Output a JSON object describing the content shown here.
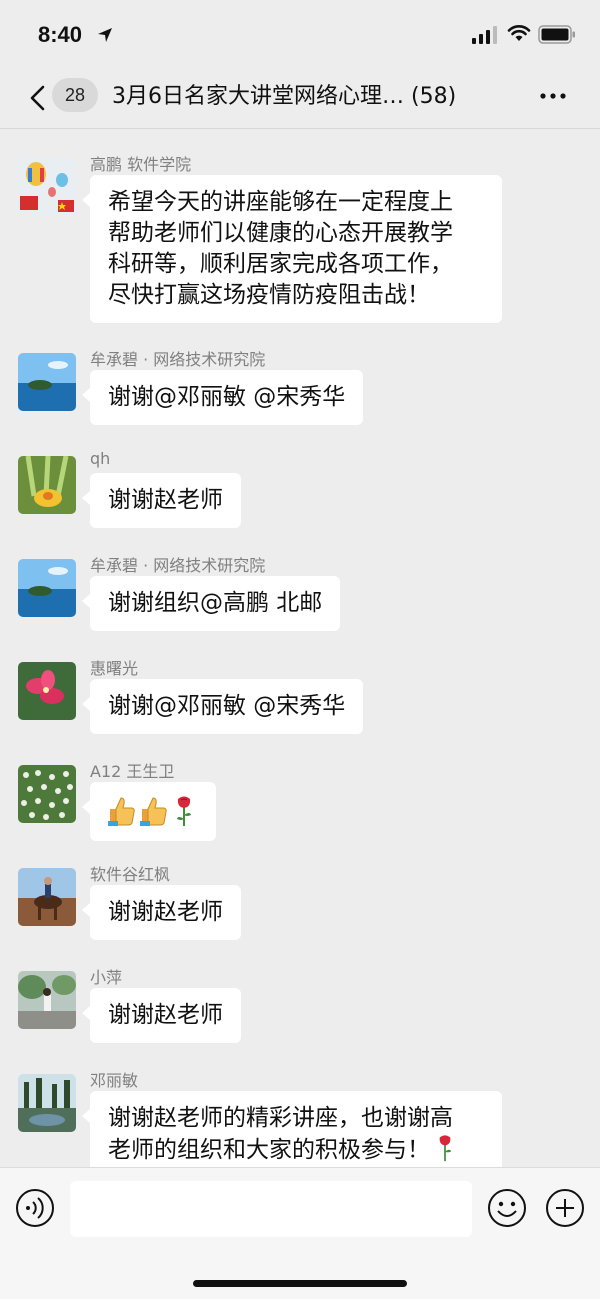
{
  "status_bar": {
    "time": "8:40",
    "icons": [
      "location-arrow-icon",
      "signal-icon",
      "wifi-icon",
      "battery-icon"
    ]
  },
  "nav": {
    "back_icon": "chevron-left-icon",
    "unread_count": "28",
    "title": "3月6日名家大讲堂网络心理… (58)",
    "more_icon": "more-dots-icon"
  },
  "messages": [
    {
      "sender": "高鹏 软件学院",
      "avatar": "balloons-photo",
      "lines": [
        "希望今天的讲座能够在一定程度上",
        "帮助老师们以健康的心态开展教学",
        "科研等，顺利居家完成各项工作，",
        "尽快打赢这场疫情防疫阻击战！"
      ]
    },
    {
      "sender": "牟承碧 · 网络技术研究院",
      "avatar": "lake-island-photo",
      "lines": [
        "谢谢@邓丽敏 @宋秀华"
      ]
    },
    {
      "sender": "qh",
      "avatar": "yellow-flower-photo",
      "lines": [
        "谢谢赵老师"
      ]
    },
    {
      "sender": "牟承碧 · 网络技术研究院",
      "avatar": "lake-island-photo",
      "lines": [
        "谢谢组织@高鹏 北邮"
      ]
    },
    {
      "sender": "惠曙光",
      "avatar": "red-flower-photo",
      "lines": [
        "谢谢@邓丽敏 @宋秀华"
      ]
    },
    {
      "sender": "A12 王生卫",
      "avatar": "white-flowers-field-photo",
      "emoji": [
        "thumbs-up-icon",
        "thumbs-up-icon",
        "rose-icon"
      ]
    },
    {
      "sender": "软件谷红枫",
      "avatar": "horse-rider-photo",
      "lines": [
        "谢谢赵老师"
      ]
    },
    {
      "sender": "小萍",
      "avatar": "garden-person-photo",
      "lines": [
        "谢谢赵老师"
      ]
    },
    {
      "sender": "邓丽敏",
      "avatar": "pond-trees-photo",
      "lines": [
        "谢谢赵老师的精彩讲座，也谢谢高",
        "老师的组织和大家的积极参与！"
      ],
      "trailing_emoji": "rose-icon"
    }
  ],
  "input_bar": {
    "voice_icon": "voice-icon",
    "input_value": "",
    "emoji_icon": "emoji-face-icon",
    "plus_icon": "plus-circle-icon"
  }
}
